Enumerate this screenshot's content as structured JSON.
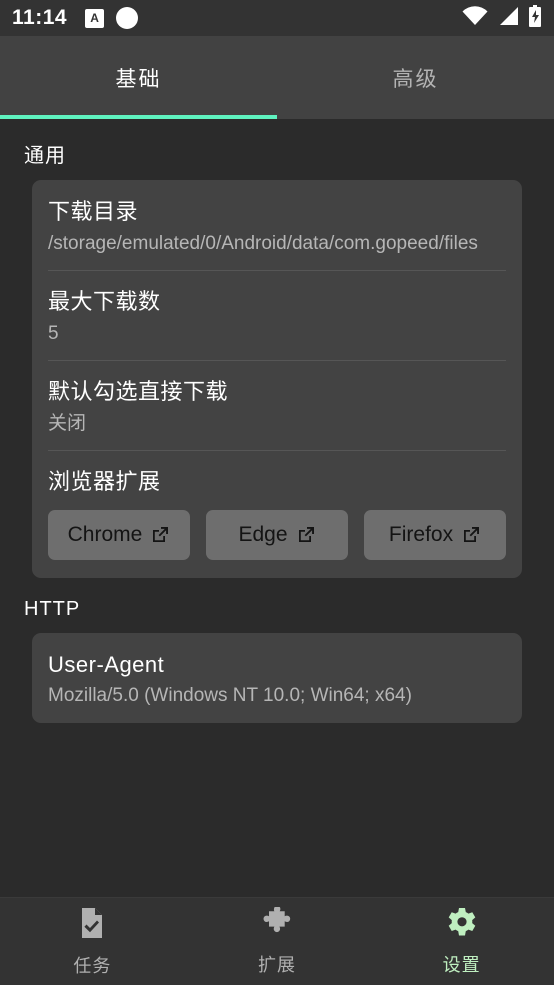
{
  "statusbar": {
    "clock": "11:14",
    "ime_badge": "A",
    "icons": [
      "ime-badge-icon",
      "white-dot-icon",
      "wifi-icon",
      "cellular-signal-icon",
      "battery-charging-icon"
    ]
  },
  "tabs": [
    {
      "label": "基础",
      "active": true
    },
    {
      "label": "高级",
      "active": false
    }
  ],
  "accent_color": "#5ff3c0",
  "sections": [
    {
      "title": "通用",
      "rows": [
        {
          "title": "下载目录",
          "sub": "/storage/emulated/0/Android/data/com.gopeed/files"
        },
        {
          "title": "最大下载数",
          "sub": "5"
        },
        {
          "title": "默认勾选直接下载",
          "sub": "关闭"
        },
        {
          "title": "浏览器扩展",
          "sub": ""
        }
      ],
      "buttons": [
        {
          "label": "Chrome",
          "icon": "external-link-icon"
        },
        {
          "label": "Edge",
          "icon": "external-link-icon"
        },
        {
          "label": "Firefox",
          "icon": "external-link-icon"
        }
      ]
    },
    {
      "title": "HTTP",
      "rows": [
        {
          "title": "User-Agent",
          "sub": "Mozilla/5.0 (Windows NT 10.0; Win64; x64)"
        }
      ]
    }
  ],
  "bottomnav": [
    {
      "label": "任务",
      "icon": "file-check-icon",
      "active": false
    },
    {
      "label": "扩展",
      "icon": "puzzle-piece-icon",
      "active": false
    },
    {
      "label": "设置",
      "icon": "gear-icon",
      "active": true
    }
  ]
}
